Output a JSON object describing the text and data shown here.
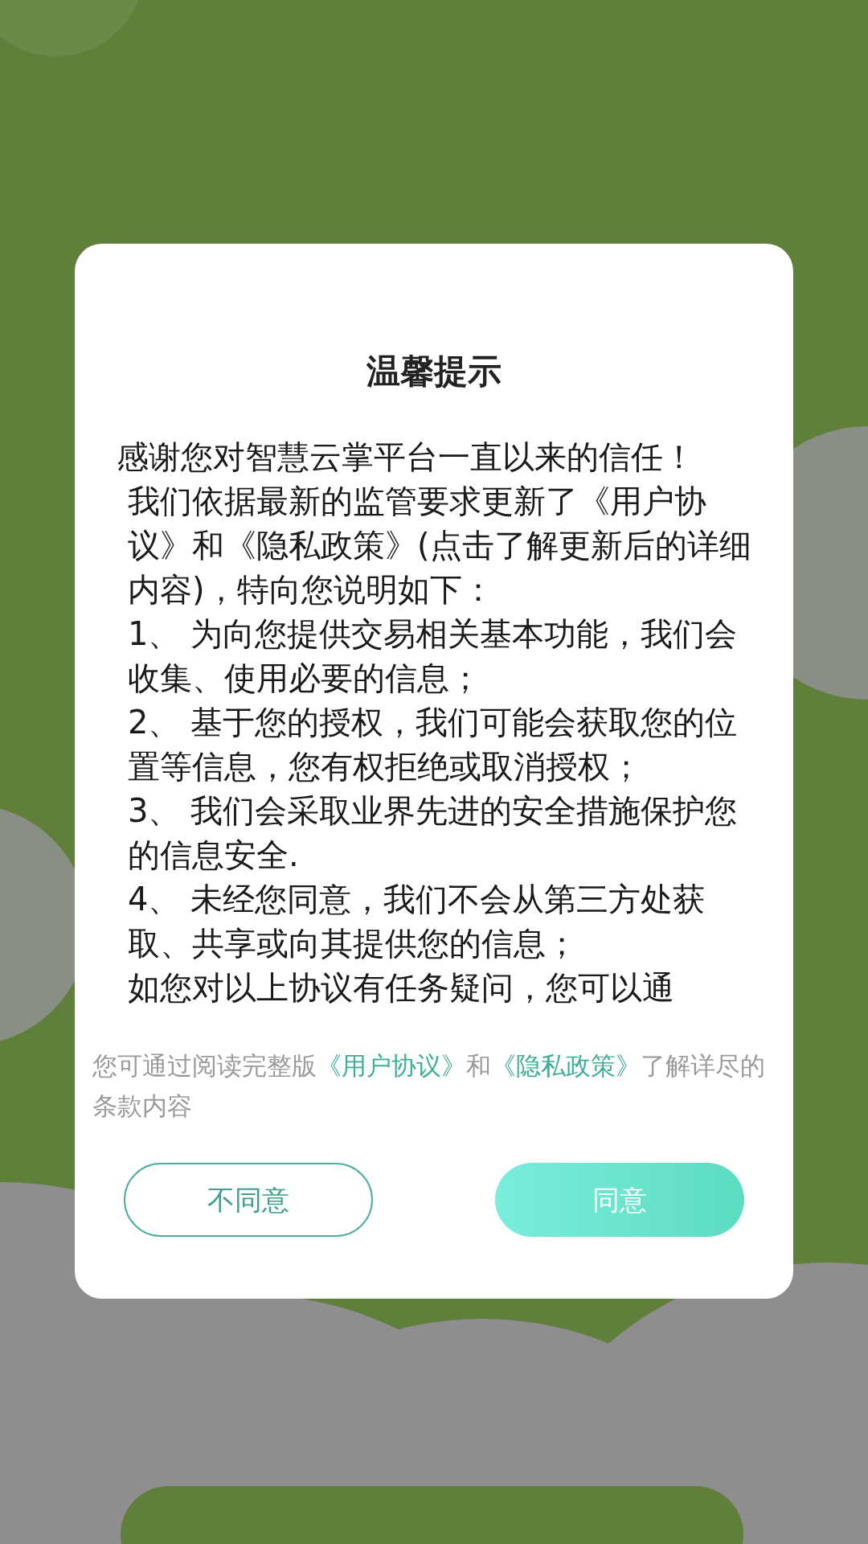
{
  "dialog": {
    "title": "温馨提示",
    "body": [
      "感谢您对智慧云掌平台一直以来的信任！",
      "我们依据最新的监管要求更新了《用户协议》和《隐私政策》(点击了解更新后的详细内容)，特向您说明如下：",
      "1、 为向您提供交易相关基本功能，我们会收集、使用必要的信息；",
      "2、 基于您的授权，我们可能会获取您的位置等信息，您有权拒绝或取消授权；",
      "3、 我们会采取业界先进的安全措施保护您的信息安全.",
      "4、 未经您同意，我们不会从第三方处获取、共享或向其提供您的信息；",
      "如您对以上协议有任务疑问，您可以通"
    ],
    "footer": [
      {
        "kind": "text",
        "text": "您可通过阅读完整版"
      },
      {
        "kind": "link",
        "text": "《用户协议》"
      },
      {
        "kind": "text",
        "text": "和"
      },
      {
        "kind": "link",
        "text": "《隐私政策》"
      },
      {
        "kind": "text",
        "text": "了解详尽的条款内容"
      }
    ],
    "buttons": [
      {
        "label": "不同意",
        "kind": "secondary"
      },
      {
        "label": "同意",
        "kind": "primary"
      }
    ]
  }
}
